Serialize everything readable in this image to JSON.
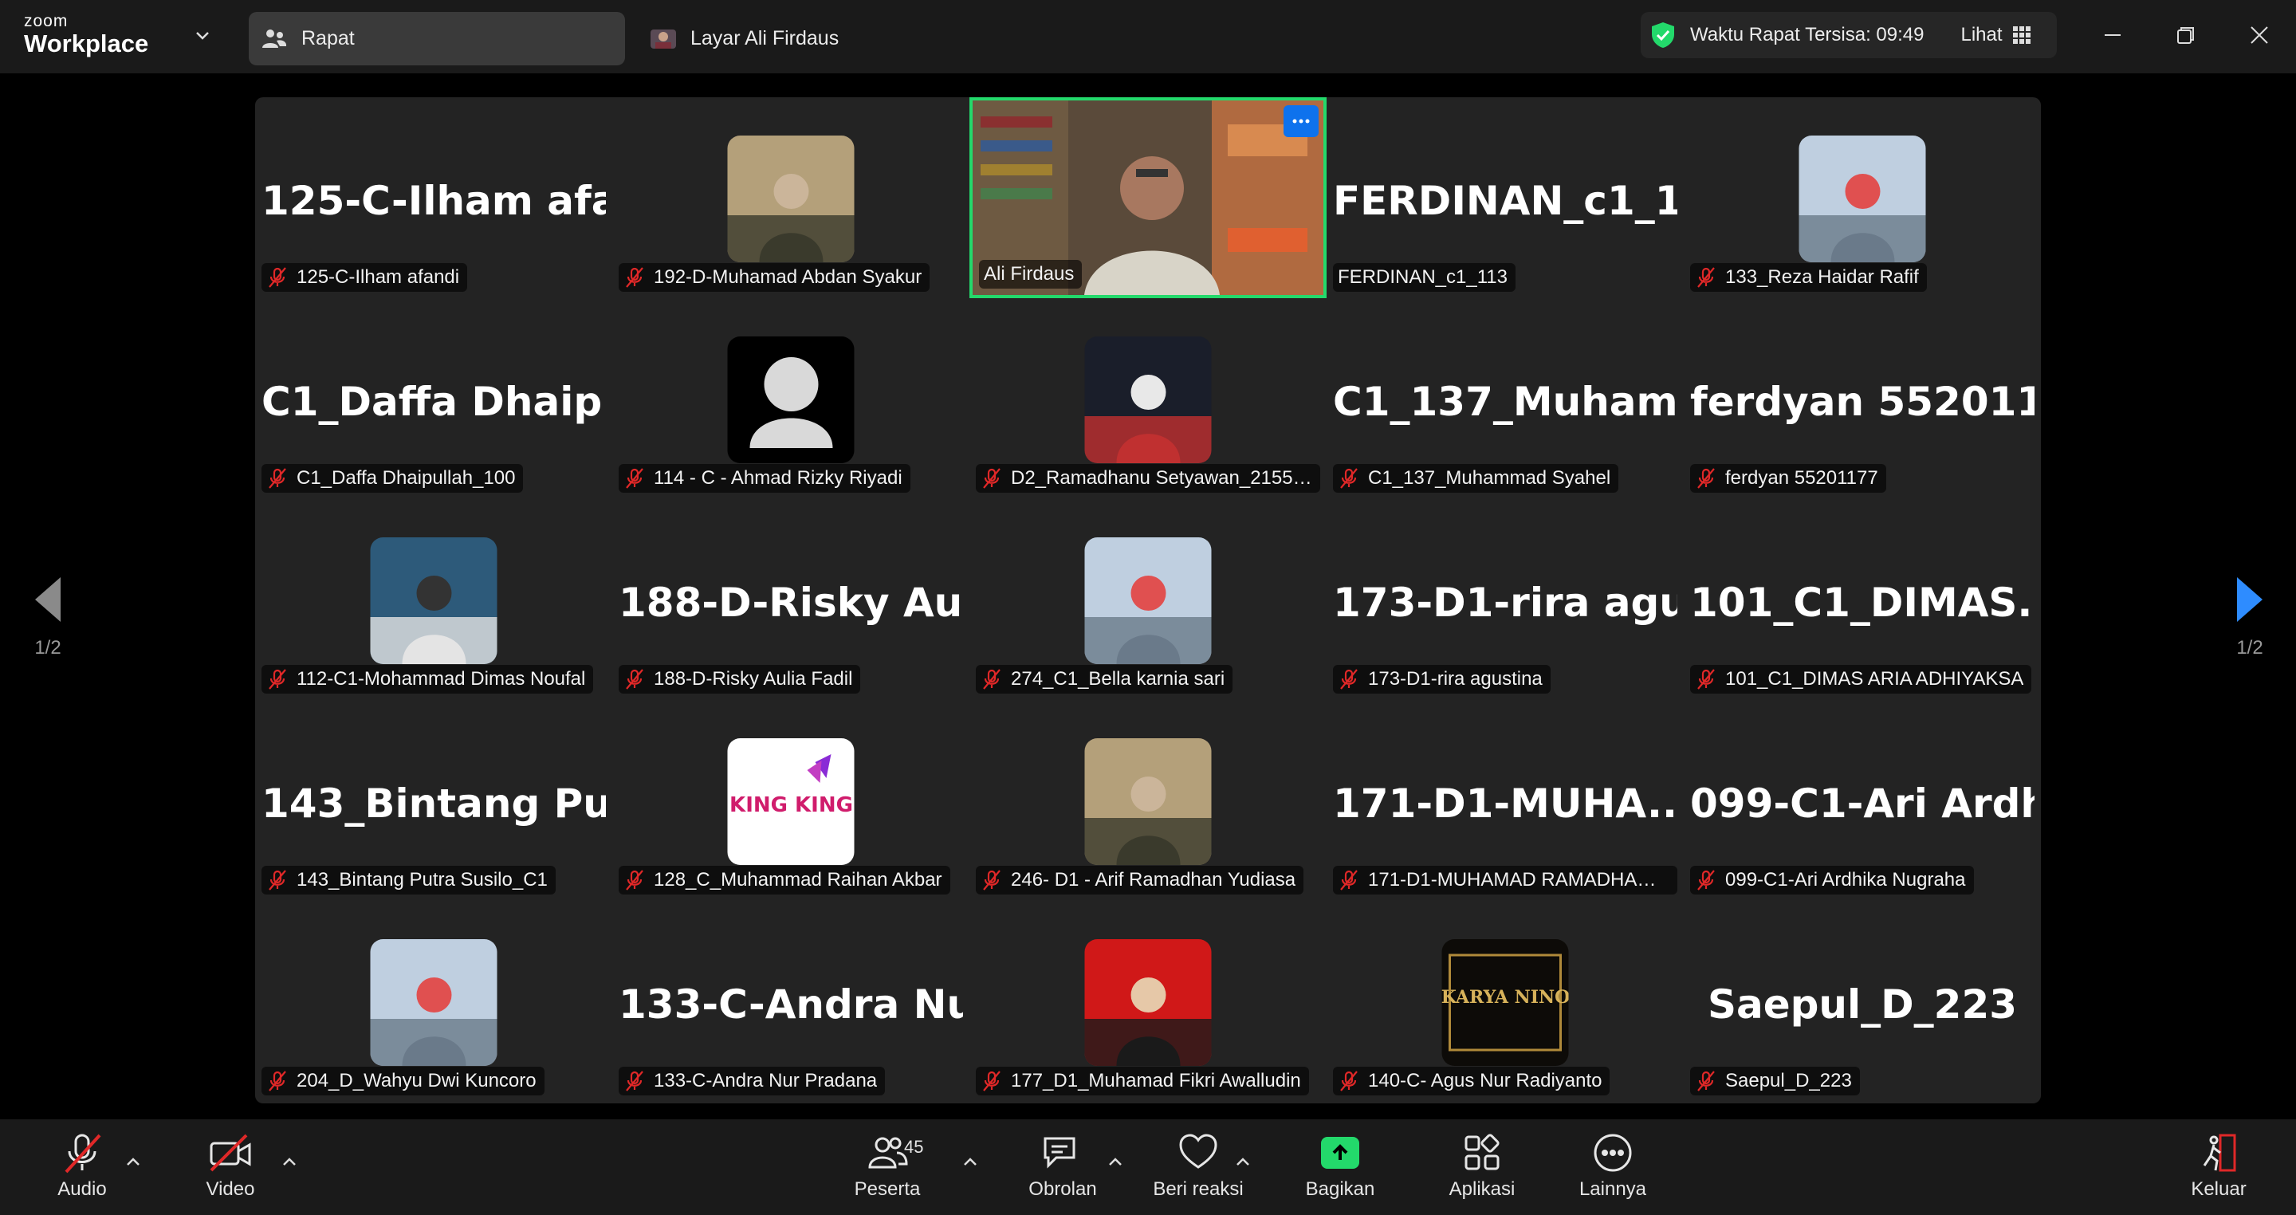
{
  "app": {
    "brand_top": "zoom",
    "brand_bottom": "Workplace"
  },
  "tabs": [
    {
      "label": "Rapat",
      "icon": "meeting-participants-icon",
      "active": true
    },
    {
      "label": "Layar Ali Firdaus",
      "icon": "shared-screen-avatar-icon",
      "active": false
    }
  ],
  "timer": {
    "text": "Waktu Rapat Tersisa: 09:49",
    "view_label": "Lihat"
  },
  "pagination": {
    "left": "1/2",
    "right": "1/2"
  },
  "participants": [
    {
      "name": "125-C-Ilham afandi",
      "display": "125-C-Ilham  afa...",
      "type": "text",
      "muted": true
    },
    {
      "name": "192-D-Muhamad Abdan Syakur",
      "type": "photo",
      "muted": true
    },
    {
      "name": "Ali Firdaus",
      "type": "video",
      "muted": false,
      "active_speaker": true
    },
    {
      "name": "FERDINAN_c1_113",
      "display": "FERDINAN_c1_1...",
      "type": "text",
      "muted": false
    },
    {
      "name": "133_Reza Haidar Rafif",
      "type": "photo",
      "muted": true
    },
    {
      "name": "C1_Daffa Dhaipullah_100",
      "display": "C1_Daffa  Dhaip...",
      "type": "text",
      "muted": true
    },
    {
      "name": "114 - C - Ahmad Rizky Riyadi",
      "type": "default-avatar",
      "muted": true
    },
    {
      "name": "D2_Ramadhanu Setyawan_2155201...",
      "type": "photo",
      "muted": true
    },
    {
      "name": "C1_137_Muhammad Syahel",
      "display": "C1_137_Muham...",
      "type": "text",
      "muted": true
    },
    {
      "name": "ferdyan 55201177",
      "display": "ferdyan 55201177",
      "type": "text",
      "muted": true
    },
    {
      "name": "112-C1-Mohammad Dimas Noufal",
      "type": "photo",
      "muted": true
    },
    {
      "name": "188-D-Risky Aulia Fadil",
      "display": "188-D-Risky  Aul...",
      "type": "text",
      "muted": true
    },
    {
      "name": "274_C1_Bella karnia sari",
      "type": "photo",
      "muted": true
    },
    {
      "name": "173-D1-rira agustina",
      "display": "173-D1-rira  agu...",
      "type": "text",
      "muted": true
    },
    {
      "name": "101_C1_DIMAS ARIA ADHIYAKSA",
      "display": "101_C1_DIMAS...",
      "type": "text",
      "muted": true
    },
    {
      "name": "143_Bintang Putra Susilo_C1",
      "display": "143_Bintang  Put...",
      "type": "text",
      "muted": true
    },
    {
      "name": "128_C_Muhammad Raihan Akbar",
      "type": "logo",
      "logo_text": "KING KING",
      "muted": true
    },
    {
      "name": "246- D1 - Arif Ramadhan Yudiasa",
      "type": "photo",
      "muted": true
    },
    {
      "name": "171-D1-MUHAMAD RAMADHAN D...",
      "display": "171-D1-MUHA...",
      "type": "text",
      "muted": true
    },
    {
      "name": "099-C1-Ari Ardhika Nugraha",
      "display": "099-C1-Ari  Ardh...",
      "type": "text",
      "muted": true
    },
    {
      "name": "204_D_Wahyu Dwi Kuncoro",
      "type": "photo",
      "muted": true
    },
    {
      "name": "133-C-Andra Nur Pradana",
      "display": "133-C-Andra  Nu...",
      "type": "text",
      "muted": true
    },
    {
      "name": "177_D1_Muhamad Fikri Awalludin",
      "type": "photo",
      "muted": true
    },
    {
      "name": "140-C- Agus Nur Radiyanto",
      "type": "logo",
      "logo_text": "KARYA NINO",
      "muted": true
    },
    {
      "name": "Saepul_D_223",
      "display": "Saepul_D_223",
      "type": "text",
      "muted": true
    }
  ],
  "toolbar": {
    "audio": "Audio",
    "video": "Video",
    "participants": "Peserta",
    "participants_count": "45",
    "chat": "Obrolan",
    "react": "Beri reaksi",
    "share": "Bagikan",
    "apps": "Aplikasi",
    "more": "Lainnya",
    "leave": "Keluar"
  },
  "colors": {
    "accent_green": "#23d96b",
    "accent_blue": "#0e72ed",
    "muted_red": "#e02828"
  }
}
